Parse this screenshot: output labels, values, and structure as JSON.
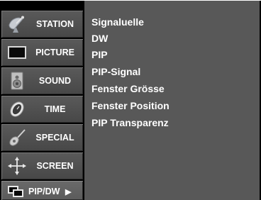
{
  "sidebar": {
    "items": [
      {
        "label": "STATION",
        "icon": "satellite-dish-icon"
      },
      {
        "label": "PICTURE",
        "icon": "tv-screen-icon"
      },
      {
        "label": "SOUND",
        "icon": "speaker-icon"
      },
      {
        "label": "TIME",
        "icon": "clock-icon"
      },
      {
        "label": "SPECIAL",
        "icon": "guitar-icon"
      },
      {
        "label": "SCREEN",
        "icon": "move-arrows-icon"
      },
      {
        "label": "PIP/DW",
        "icon": "pip-windows-icon",
        "arrow": "▶",
        "active": true
      }
    ]
  },
  "submenu": {
    "items": [
      "Signaluelle",
      "DW",
      "PIP",
      "PIP-Signal",
      "Fenster Grösse",
      "Fenster Position",
      "PIP Transparenz"
    ]
  },
  "colors": {
    "osd_background": "#000000",
    "tab_background": "#4f4f4f",
    "submenu_background": "#585858",
    "text": "#ffffff"
  }
}
